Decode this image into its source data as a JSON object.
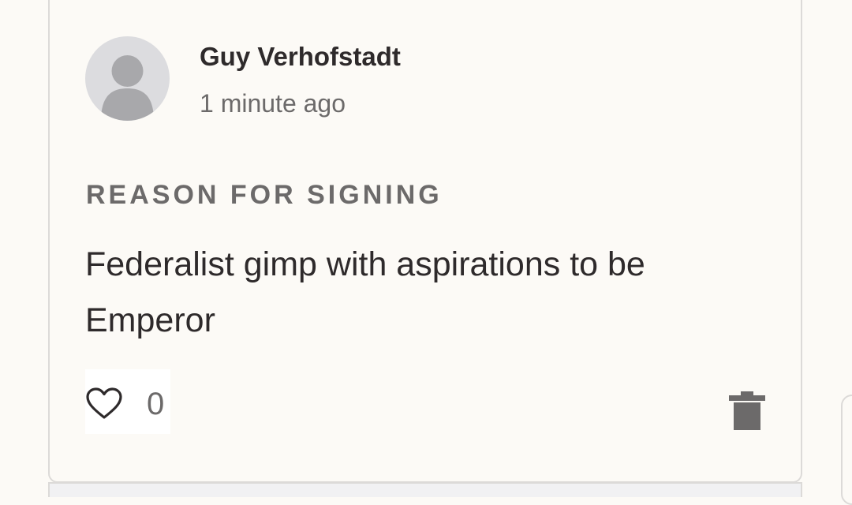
{
  "comment": {
    "author_name": "Guy Verhofstadt",
    "timestamp": "1 minute ago",
    "reason_heading": "REASON FOR SIGNING",
    "reason_text": "Federalist gimp with aspirations to be Emperor",
    "like_count": "0"
  },
  "icons": {
    "avatar": "user-silhouette-icon",
    "like": "heart-outline-icon",
    "delete": "trash-icon"
  },
  "colors": {
    "background": "#fcfaf6",
    "border": "#dcdad8",
    "text_primary": "#2e2a2b",
    "text_secondary": "#6c6a6a",
    "avatar_bg": "#dcdcdf",
    "avatar_figure": "#a8a8ab"
  }
}
